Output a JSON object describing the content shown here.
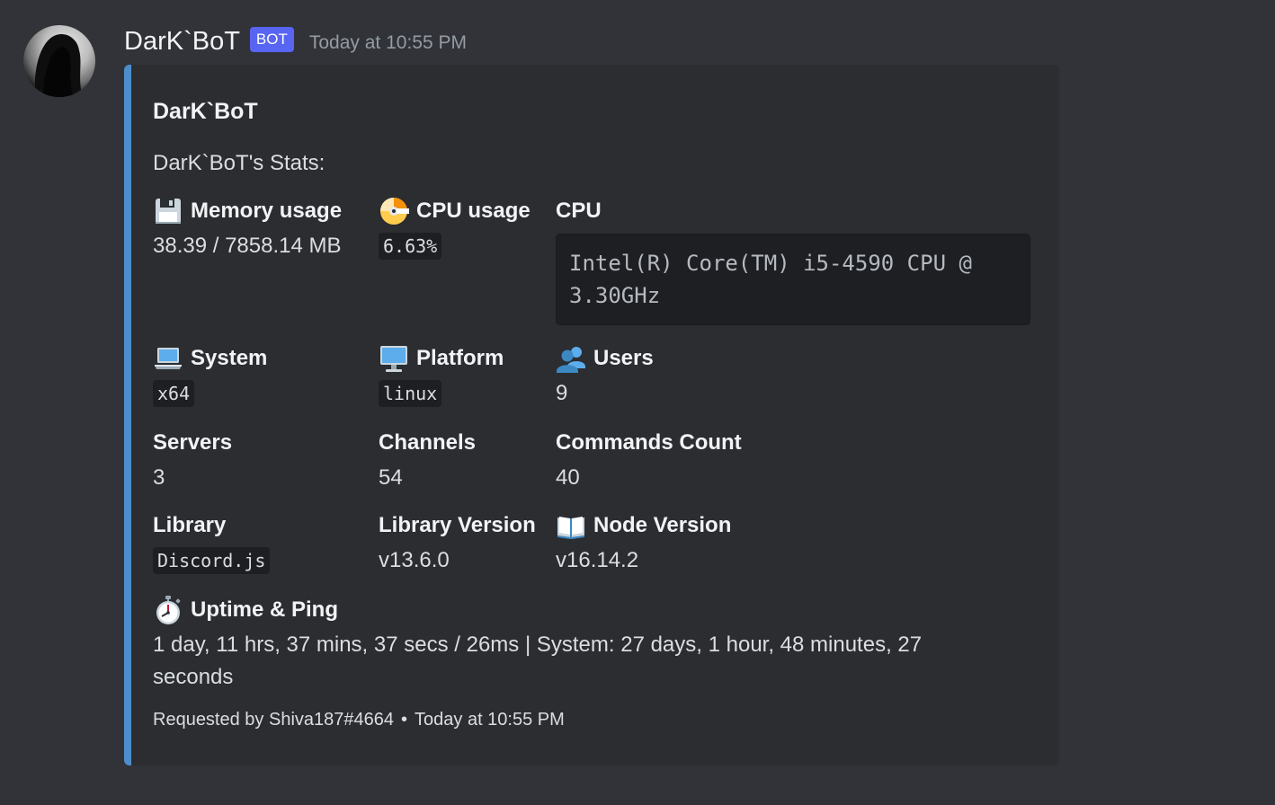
{
  "author": {
    "username": "DarK`BoT",
    "tag": "BOT",
    "timestamp": "Today at 10:55 PM"
  },
  "embed": {
    "accent_color": "#4e8dcc",
    "title": "DarK`BoT",
    "description": "DarK`BoT's Stats:",
    "fields": {
      "memory": {
        "icon": "floppy-disk-icon",
        "name": "Memory usage",
        "value": "38.39 / 7858.14 MB"
      },
      "cpu_usage": {
        "icon": "dvd-icon",
        "name": "CPU usage",
        "value": "6.63%"
      },
      "cpu": {
        "name": "CPU",
        "value": "Intel(R) Core(TM) i5-4590 CPU @ 3.30GHz"
      },
      "system": {
        "icon": "laptop-icon",
        "name": "System",
        "value": "x64"
      },
      "platform": {
        "icon": "desktop-computer-icon",
        "name": "Platform",
        "value": "linux"
      },
      "users": {
        "icon": "users-icon",
        "name": "Users",
        "value": "9"
      },
      "servers": {
        "name": "Servers",
        "value": "3"
      },
      "channels": {
        "name": "Channels",
        "value": "54"
      },
      "commands": {
        "name": "Commands Count",
        "value": "40"
      },
      "library": {
        "name": "Library",
        "value": "Discord.js"
      },
      "library_version": {
        "name": "Library Version",
        "value": "v13.6.0"
      },
      "node_version": {
        "icon": "open-book-icon",
        "name": "Node Version",
        "value": "v16.14.2"
      },
      "uptime": {
        "icon": "stopwatch-icon",
        "name": "Uptime & Ping",
        "value": "1 day, 11 hrs, 37 mins, 37 secs / 26ms | System: 27 days, 1 hour, 48 minutes, 27 seconds"
      }
    },
    "footer": {
      "requested_by": "Requested by Shiva187#4664",
      "separator": "•",
      "timestamp": "Today at 10:55 PM"
    }
  }
}
